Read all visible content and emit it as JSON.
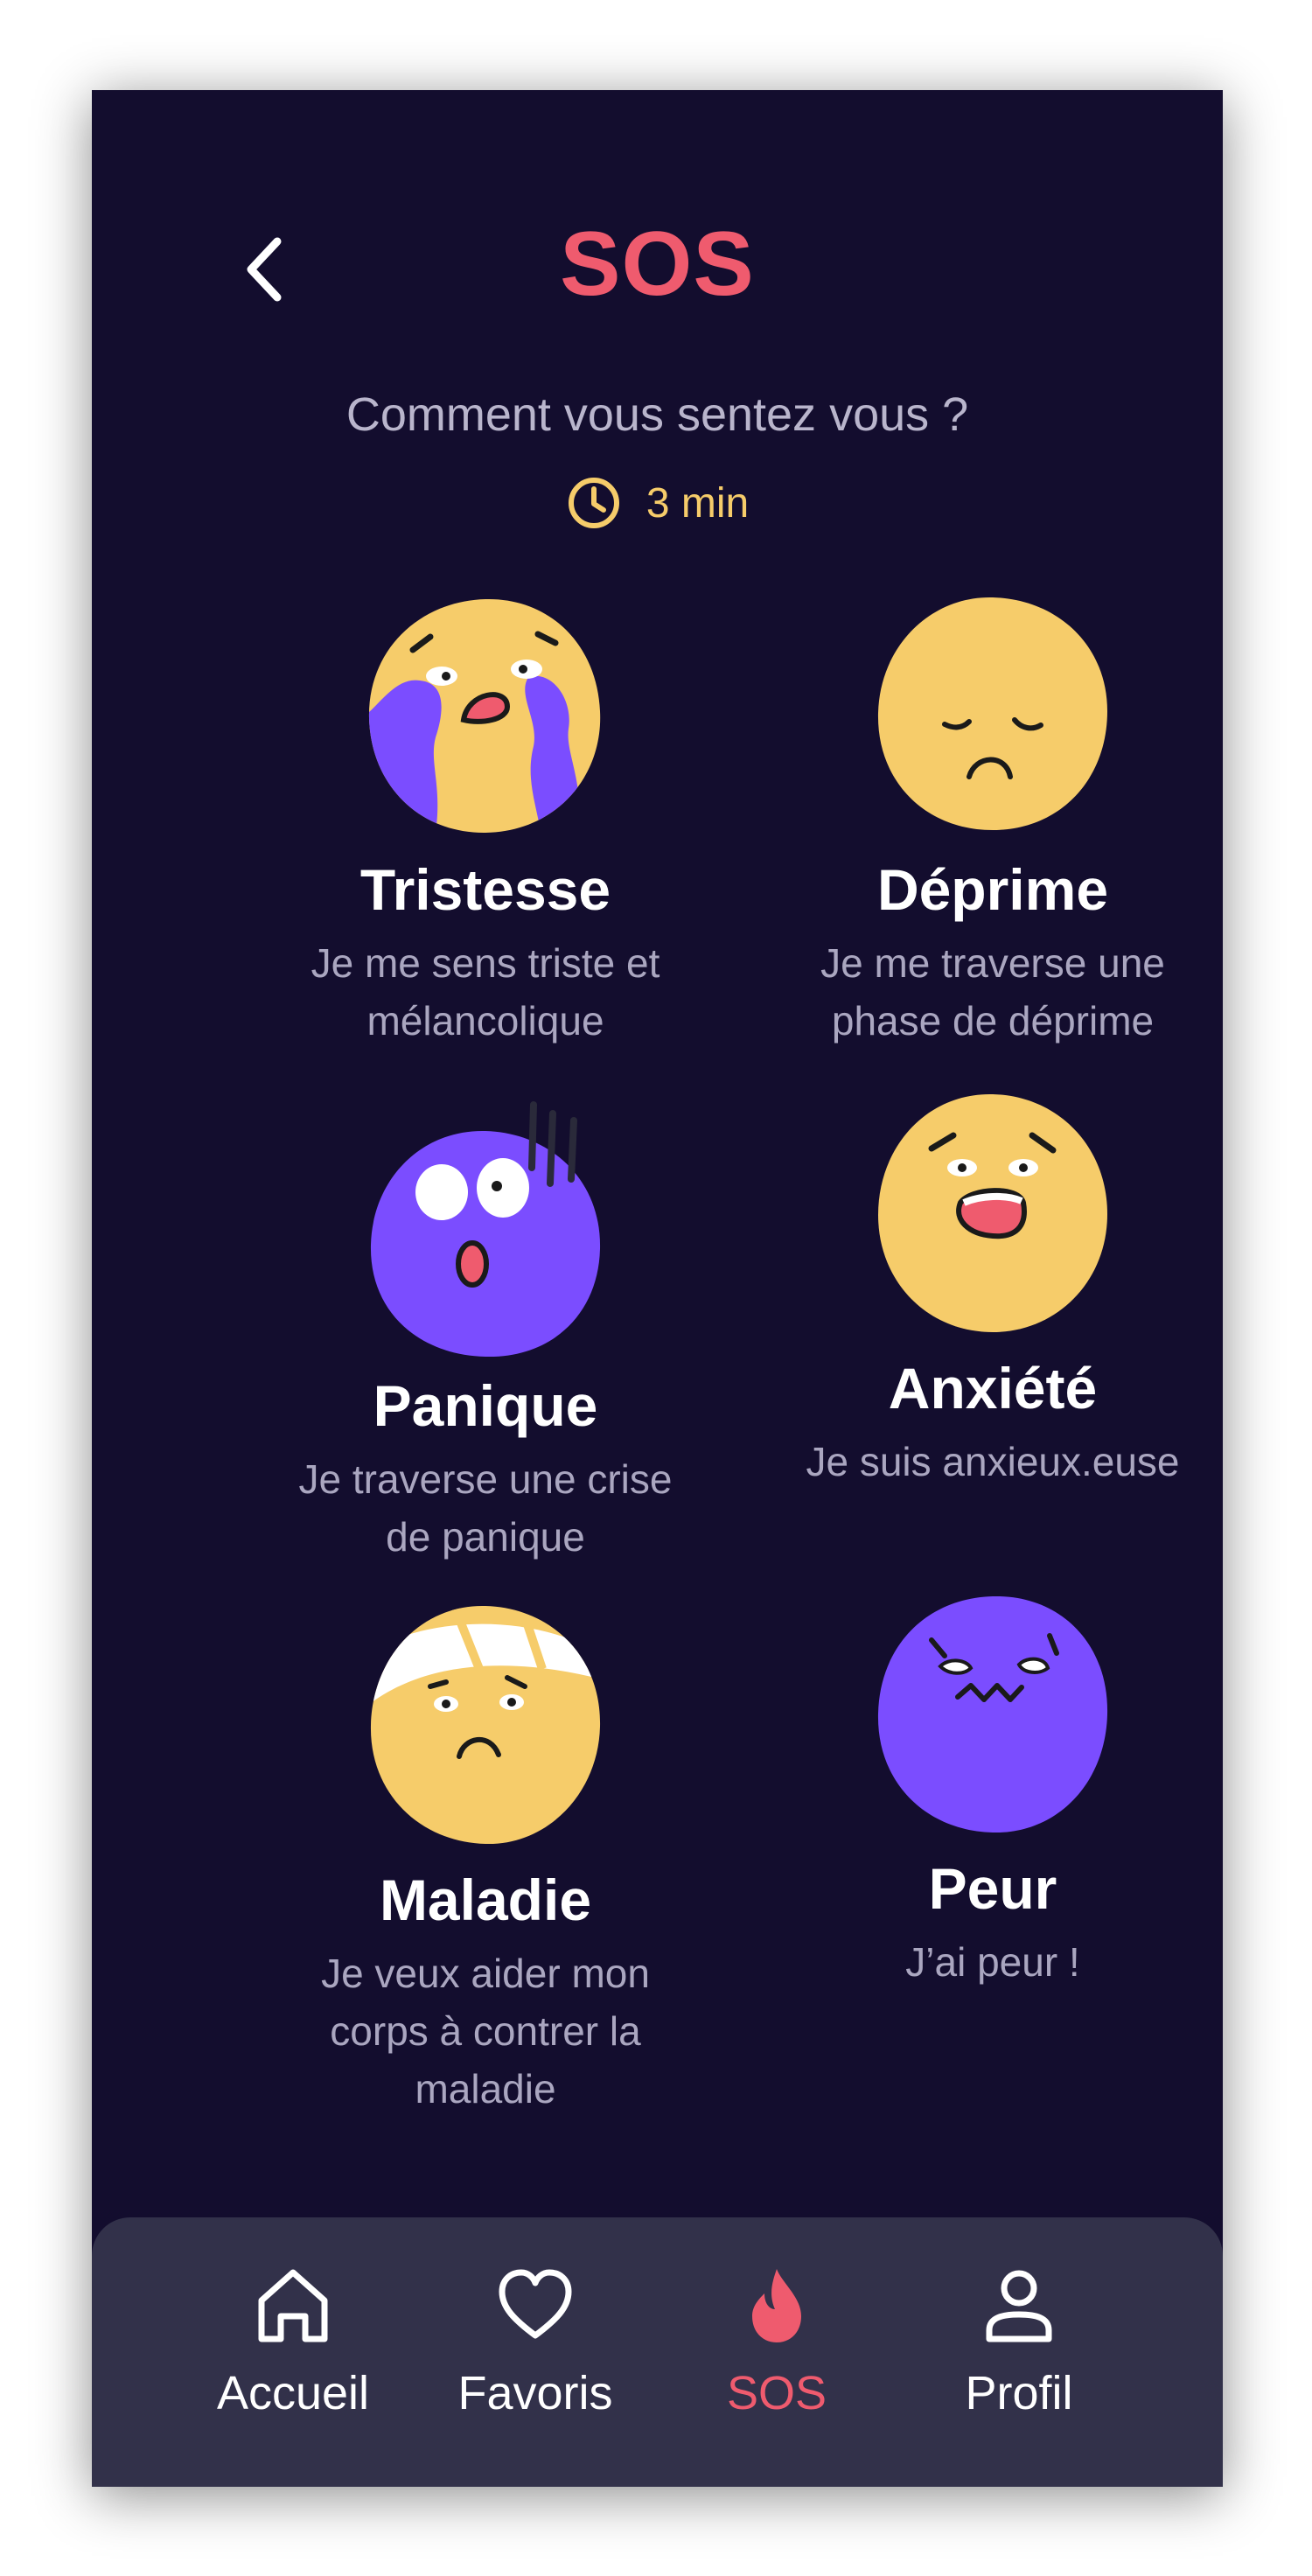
{
  "header": {
    "title": "SOS",
    "back_icon": "chevron-left-icon"
  },
  "prompt": "Comment vous sentez vous ?",
  "duration": {
    "icon": "clock-icon",
    "label": "3 min"
  },
  "colors": {
    "background": "#130d2e",
    "accent": "#ef5b6e",
    "yellow": "#f6cc6a",
    "purple": "#7b4dff",
    "tabbar": "#32314a"
  },
  "moods": [
    {
      "title": "Tristesse",
      "description": "Je me sens triste et mélancolique",
      "icon": "crying-face-icon"
    },
    {
      "title": "Déprime",
      "description": "Je me traverse une phase de déprime",
      "icon": "sad-face-icon"
    },
    {
      "title": "Panique",
      "description": "Je traverse une crise de panique",
      "icon": "panic-face-icon"
    },
    {
      "title": "Anxiété",
      "description": "Je suis anxieux.euse",
      "icon": "anxious-face-icon"
    },
    {
      "title": "Maladie",
      "description": "Je veux aider mon corps à contrer la maladie",
      "icon": "sick-face-icon"
    },
    {
      "title": "Peur",
      "description": "J’ai peur !",
      "icon": "scared-face-icon"
    }
  ],
  "tabbar": {
    "items": [
      {
        "label": "Accueil",
        "icon": "home-icon",
        "active": false
      },
      {
        "label": "Favoris",
        "icon": "heart-icon",
        "active": false
      },
      {
        "label": "SOS",
        "icon": "flame-icon",
        "active": true
      },
      {
        "label": "Profil",
        "icon": "user-icon",
        "active": false
      }
    ]
  }
}
